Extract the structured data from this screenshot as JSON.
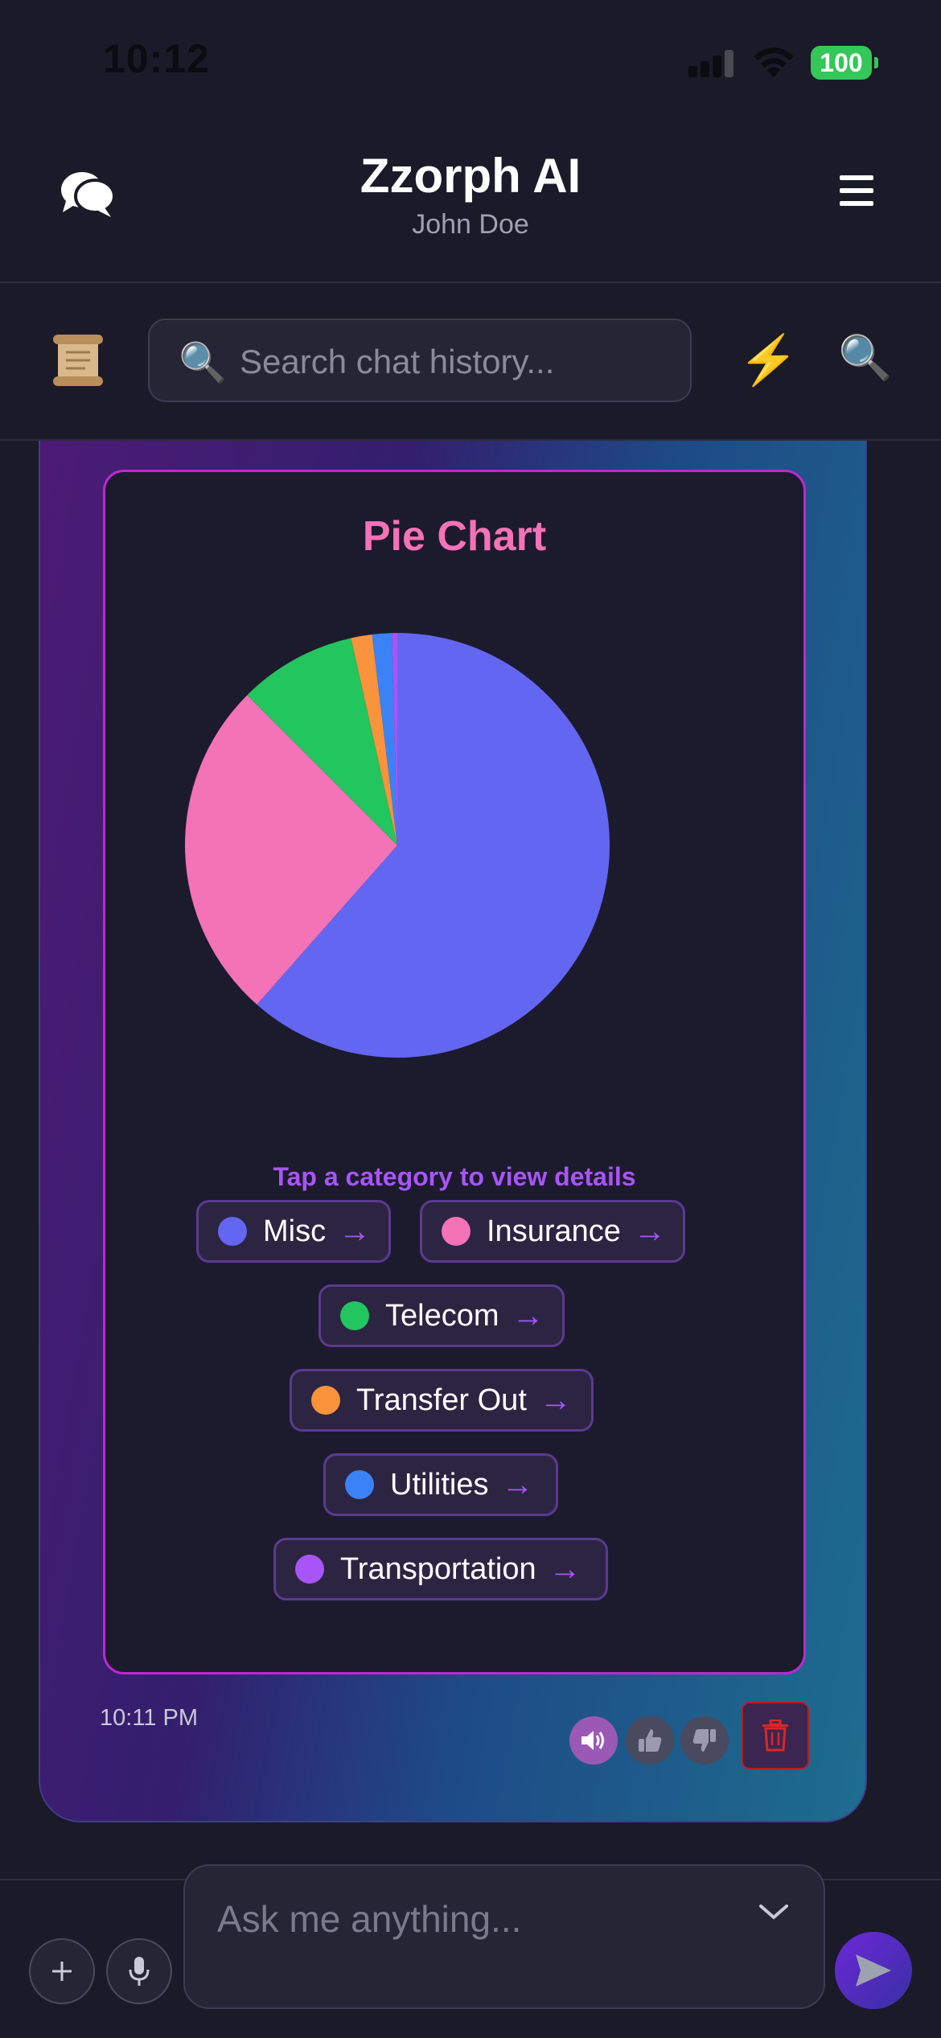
{
  "status_bar": {
    "time": "10:12",
    "battery": "100"
  },
  "header": {
    "title": "Zzorph AI",
    "subtitle": "John Doe"
  },
  "search": {
    "placeholder": "Search chat history..."
  },
  "colors": {
    "accent": "#a855f7",
    "chart_border": "#c026d3",
    "title_pink": "#f472b6",
    "delete_red": "#b91c1c"
  },
  "message": {
    "time": "10:11 PM",
    "chart": {
      "title": "Pie Chart",
      "hint": "Tap a category to view details"
    }
  },
  "chart_data": {
    "type": "pie",
    "title": "Pie Chart",
    "categories": [
      "Misc",
      "Insurance",
      "Telecom",
      "Transfer Out",
      "Utilities",
      "Transportation"
    ],
    "values": [
      61.5,
      26.0,
      9.0,
      1.6,
      1.5,
      0.4
    ],
    "colors": [
      "#6366f1",
      "#f472b6",
      "#22c55e",
      "#fb923c",
      "#3b82f6",
      "#a855f7"
    ]
  },
  "legend": [
    {
      "label": "Misc",
      "color": "#6366f1"
    },
    {
      "label": "Insurance",
      "color": "#f472b6"
    },
    {
      "label": "Telecom",
      "color": "#22c55e"
    },
    {
      "label": "Transfer Out",
      "color": "#fb923c"
    },
    {
      "label": "Utilities",
      "color": "#3b82f6"
    },
    {
      "label": "Transportation",
      "color": "#a855f7"
    }
  ],
  "actions": [
    "speaker-icon",
    "thumbs-up-icon",
    "thumbs-down-icon",
    "trash-icon"
  ],
  "composer": {
    "placeholder": "Ask me anything..."
  }
}
